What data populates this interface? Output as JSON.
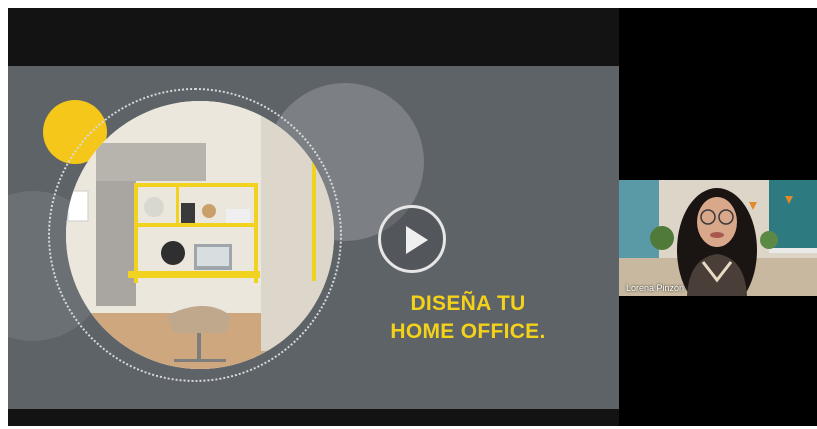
{
  "slide": {
    "title_line1": "DISEÑA TU",
    "title_line2": "HOME OFFICE.",
    "accent_color": "#f5c71b",
    "background_color": "#5e6367"
  },
  "controls": {
    "play_icon": "play-icon"
  },
  "participant": {
    "name": "Lorena Pinzón"
  }
}
